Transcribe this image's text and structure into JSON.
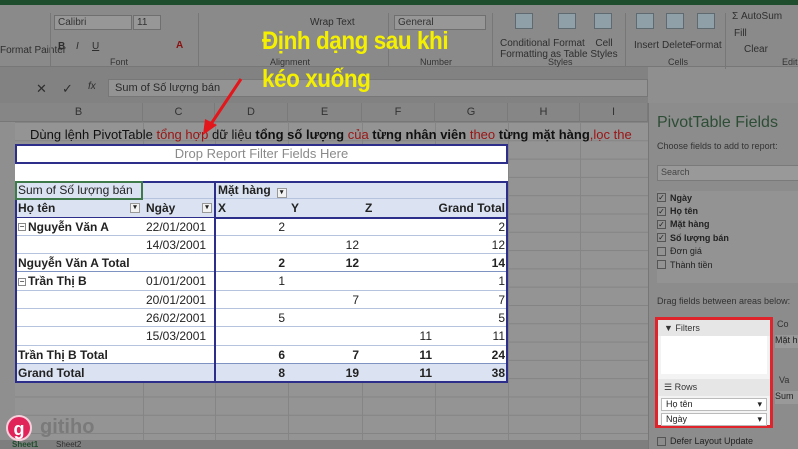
{
  "ribbon": {
    "clipboard_label": "Format Painter",
    "font_name": "Calibri",
    "font_size": "11",
    "font_group": "Font",
    "wrap_text": "Wrap Text",
    "alignment_group": "Alignment",
    "number_format": "General",
    "number_group": "Number",
    "conditional_formatting": "Conditional Formatting",
    "format_as_table": "Format as Table",
    "cell_styles": "Cell Styles",
    "styles_group": "Styles",
    "insert": "Insert",
    "delete": "Delete",
    "format": "Format",
    "cells_group": "Cells",
    "autosum": "AutoSum",
    "fill": "Fill",
    "clear": "Clear",
    "editing_group": "Editing"
  },
  "formula_bar": {
    "value": "Sum of Số lượng bán",
    "fx": "fx"
  },
  "annotation": {
    "line1": "Định dạng sau khi",
    "line2": "kéo xuống"
  },
  "columns": [
    "B",
    "C",
    "D",
    "E",
    "F",
    "G",
    "H",
    "I"
  ],
  "instruction": [
    {
      "t": "Dùng lệnh PivotTable ",
      "s": ""
    },
    {
      "t": "tổng hợp",
      "s": "r"
    },
    {
      "t": " dữ liệu ",
      "s": ""
    },
    {
      "t": "tổng số lượng",
      "s": "b"
    },
    {
      "t": " của ",
      "s": "r"
    },
    {
      "t": "từng nhân viên",
      "s": "b"
    },
    {
      "t": " theo ",
      "s": "r"
    },
    {
      "t": "từng mặt hàng",
      "s": "b"
    },
    {
      "t": ",lọc the",
      "s": "r"
    }
  ],
  "pivot": {
    "drop_filter": "Drop Report Filter Fields Here",
    "value_field": "Sum of Số lượng bán",
    "column_field": "Mặt hàng",
    "header": [
      "Họ tên",
      "Ngày",
      "X",
      "Y",
      "Z",
      "Grand Total"
    ],
    "rows": [
      {
        "type": "data",
        "cells": [
          "Nguyễn Văn A",
          "22/01/2001",
          "2",
          "",
          "",
          "2"
        ],
        "expander": true
      },
      {
        "type": "data",
        "cells": [
          "",
          "14/03/2001",
          "",
          "12",
          "",
          "12"
        ]
      },
      {
        "type": "tot",
        "cells": [
          "Nguyễn Văn A Total",
          "",
          "2",
          "12",
          "",
          "14"
        ]
      },
      {
        "type": "data",
        "cells": [
          "Trần Thị B",
          "01/01/2001",
          "1",
          "",
          "",
          "1"
        ],
        "expander": true
      },
      {
        "type": "data",
        "cells": [
          "",
          "20/01/2001",
          "",
          "7",
          "",
          "7"
        ]
      },
      {
        "type": "data",
        "cells": [
          "",
          "26/02/2001",
          "5",
          "",
          "",
          "5"
        ]
      },
      {
        "type": "data",
        "cells": [
          "",
          "15/03/2001",
          "",
          "",
          "11",
          "11"
        ]
      },
      {
        "type": "tot",
        "cells": [
          "Trần Thị B Total",
          "",
          "6",
          "7",
          "11",
          "24"
        ]
      },
      {
        "type": "gt",
        "cells": [
          "Grand Total",
          "",
          "8",
          "19",
          "11",
          "38"
        ]
      }
    ]
  },
  "panel": {
    "title": "PivotTable Fields",
    "subtitle": "Choose fields to add to report:",
    "search_placeholder": "Search",
    "fields": [
      {
        "name": "Ngày",
        "checked": true
      },
      {
        "name": "Họ tên",
        "checked": true
      },
      {
        "name": "Mặt hàng",
        "checked": true
      },
      {
        "name": "Số lượng bán",
        "checked": true
      },
      {
        "name": "Đơn giá",
        "checked": false
      },
      {
        "name": "Thành tiền",
        "checked": false
      }
    ],
    "drag_label": "Drag fields between areas below:",
    "filters": "Filters",
    "columns": "Co",
    "columns_item": "Mặt h",
    "rows": "Rows",
    "rows_items": [
      "Họ tên",
      "Ngày"
    ],
    "values": "Va",
    "values_item": "Sum o",
    "defer": "Defer Layout Update"
  },
  "sheets": [
    "Sheet1",
    "Sheet2"
  ],
  "watermark": "gitiho"
}
